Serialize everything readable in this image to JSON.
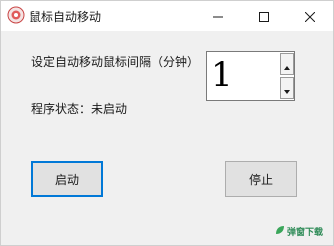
{
  "window": {
    "title": "鼠标自动移动",
    "icon": "mouse-app-icon"
  },
  "controls": {
    "interval_label": "设定自动移动鼠标间隔（分钟）",
    "interval_value": "1",
    "status_label": "程序状态：未启动",
    "start_button": "启动",
    "stop_button": "停止"
  },
  "watermark": {
    "text": "弹窗下载",
    "color": "#2e8b57"
  },
  "colors": {
    "focus_border": "#0078d7",
    "window_bg": "#f0f0f0"
  }
}
